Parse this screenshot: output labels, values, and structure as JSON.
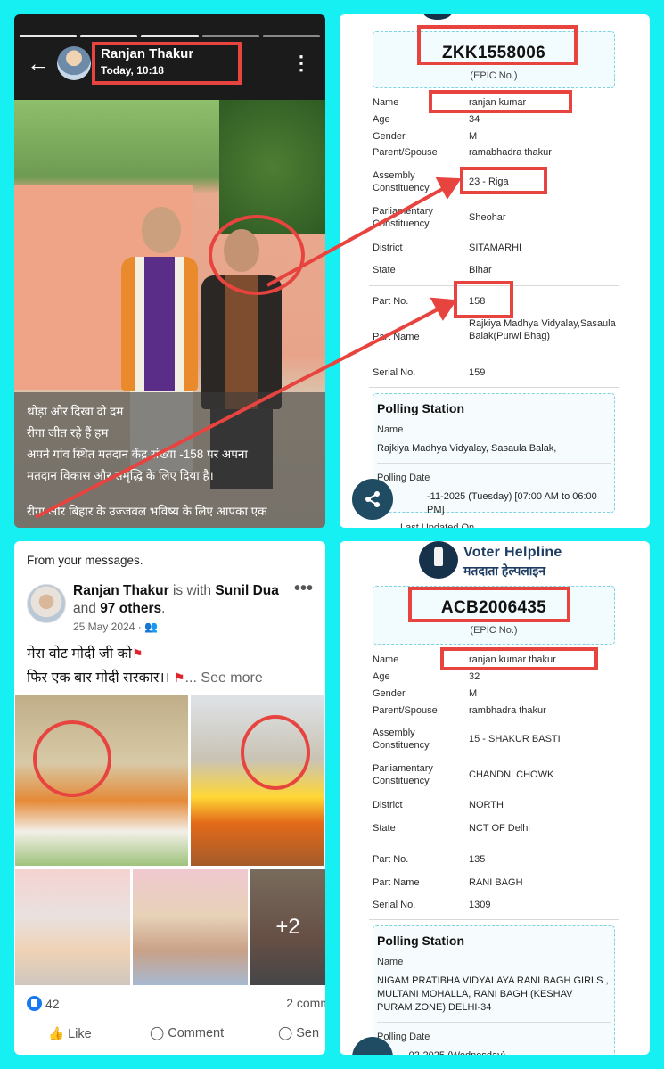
{
  "status": {
    "name": "Ranjan Thakur",
    "time": "Today, 10:18",
    "caption_lines": [
      "थोड़ा और दिखा दो दम",
      "रीगा जीत रहे हैं हम",
      "अपने गांव स्थित मतदान केंद्र संख्या -158 पर अपना",
      "मतदान विकास और समृद्धि के लिए दिया है।",
      "रीगा और बिहार के उज्जवल भविष्य के लिए आपका एक"
    ]
  },
  "epic1": {
    "epic_no": "ZKK1558006",
    "epic_label": "(EPIC No.)",
    "fields": [
      {
        "k": "Name",
        "v": "ranjan kumar"
      },
      {
        "k": "Age",
        "v": "34"
      },
      {
        "k": "Gender",
        "v": "M"
      },
      {
        "k": "Parent/Spouse",
        "v": "ramabhadra thakur"
      },
      {
        "k": "Assembly Constituency",
        "v": "23 - Riga"
      },
      {
        "k": "Parliamentary Constituency",
        "v": "Sheohar"
      },
      {
        "k": "District",
        "v": "SITAMARHI"
      },
      {
        "k": "State",
        "v": "Bihar"
      },
      {
        "k": "Part No.",
        "v": "158"
      },
      {
        "k": "Part Name",
        "v": "Rajkiya  Madhya Vidyalay,Sasaula Balak(Purwi Bhag)"
      },
      {
        "k": "Serial No.",
        "v": "159"
      }
    ],
    "ps_title": "Polling Station",
    "ps_name_label": "Name",
    "ps_name": "Rajkiya Madhya Vidyalay, Sasaula Balak,",
    "ps_date_label": "Polling Date",
    "ps_date": "-11-2025 (Tuesday) [07:00 AM to 06:00 PM]",
    "ps_updated": "Last Updated On"
  },
  "fb": {
    "from": "From your messages.",
    "poster": "Ranjan Thakur",
    "with_text": "is with",
    "tagged": "Sunil Dua",
    "and_text": "and",
    "others": "97 others",
    "date": "25 May 2024 ·",
    "line1": "मेरा वोट मोदी जी को",
    "line2": "फिर एक बार मोदी सरकार।।",
    "see_more": "See more",
    "extra_photos": "+2",
    "likes": "42",
    "comments": "2 comm",
    "like_label": "Like",
    "comment_label": "Comment",
    "send_label": "Sen"
  },
  "epic2": {
    "brand_en": "Voter Helpline",
    "brand_hi": "मतदाता हेल्पलाइन",
    "epic_no": "ACB2006435",
    "epic_label": "(EPIC No.)",
    "fields": [
      {
        "k": "Name",
        "v": "ranjan kumar thakur"
      },
      {
        "k": "Age",
        "v": "32"
      },
      {
        "k": "Gender",
        "v": "M"
      },
      {
        "k": "Parent/Spouse",
        "v": "rambhadra thakur"
      },
      {
        "k": "Assembly Constituency",
        "v": "15 - SHAKUR BASTI"
      },
      {
        "k": "Parliamentary Constituency",
        "v": "CHANDNI CHOWK"
      },
      {
        "k": "District",
        "v": "NORTH"
      },
      {
        "k": "State",
        "v": "NCT OF Delhi"
      },
      {
        "k": "Part No.",
        "v": "135"
      },
      {
        "k": "Part Name",
        "v": "RANI BAGH"
      },
      {
        "k": "Serial No.",
        "v": "1309"
      }
    ],
    "ps_title": "Polling Station",
    "ps_name_label": "Name",
    "ps_name": "NIGAM PRATIBHA VIDYALAYA RANI BAGH GIRLS , MULTANI MOHALLA, RANI BAGH (KESHAV PURAM ZONE) DELHI-34",
    "ps_date_label": "Polling Date",
    "ps_date": "-02-2025 (Wednesday)"
  },
  "colors": {
    "background": "#16f0f2",
    "annotation": "#e8443f",
    "dashed_border": "#7fd3de",
    "fb_blue": "#1877f2",
    "brand_navy": "#1d3c63"
  }
}
